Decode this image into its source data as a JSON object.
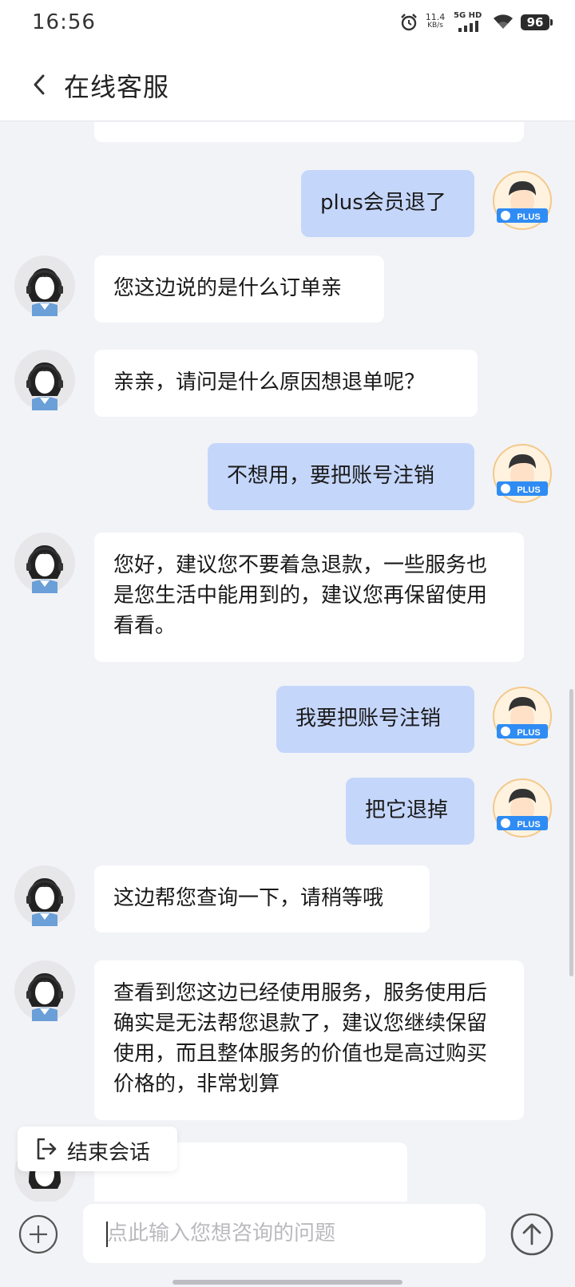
{
  "status_bar": {
    "time": "16:56",
    "speed_value": "11.4",
    "speed_unit": "KB/s",
    "network": "5G HD",
    "battery": "96"
  },
  "header": {
    "title": "在线客服",
    "back_icon": "chevron-left-icon"
  },
  "messages": [
    {
      "from": "user",
      "text": "plus会员退了",
      "avatar_badge": "PLUS"
    },
    {
      "from": "bot",
      "text": "您这边说的是什么订单亲"
    },
    {
      "from": "bot",
      "text": "亲亲，请问是什么原因想退单呢？"
    },
    {
      "from": "user",
      "text": "不想用，要把账号注销",
      "avatar_badge": "PLUS"
    },
    {
      "from": "bot",
      "text": "您好，建议您不要着急退款，一些服务也是您生活中能用到的，建议您再保留使用看看。"
    },
    {
      "from": "user",
      "text": "我要把账号注销",
      "avatar_badge": "PLUS"
    },
    {
      "from": "user",
      "text": "把它退掉",
      "avatar_badge": "PLUS"
    },
    {
      "from": "bot",
      "text": "这边帮您查询一下，请稍等哦"
    },
    {
      "from": "bot",
      "text": "查看到您这边已经使用服务，服务使用后确实是无法帮您退款了，建议您继续保留使用，而且整体服务的价值也是高过购买价格的，非常划算"
    }
  ],
  "end_session": {
    "label": "结束会话",
    "icon": "exit-icon"
  },
  "input": {
    "placeholder": "点此输入您想咨询的问题",
    "value": "",
    "plus_icon": "plus-circle-icon",
    "send_icon": "arrow-up-circle-icon"
  },
  "colors": {
    "user_bubble": "#c5d6fb",
    "bot_bubble": "#ffffff",
    "background": "#f2f3f7",
    "plus_badge": "#2f8cf4"
  }
}
